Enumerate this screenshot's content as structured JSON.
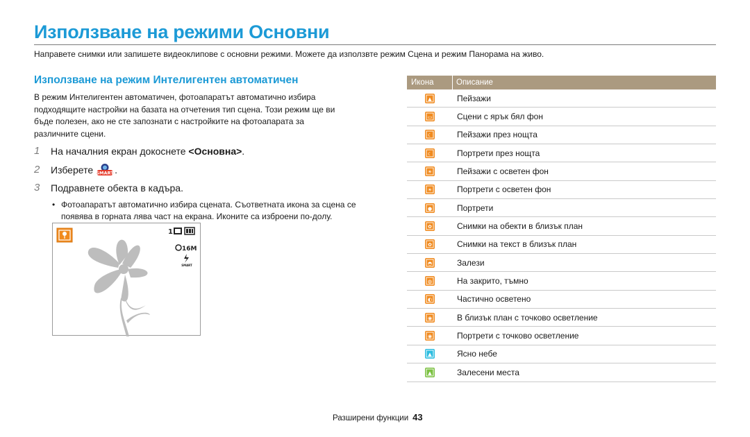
{
  "page": {
    "title": "Използване на режими Основни",
    "intro": "Направете снимки или запишете видеоклипове с основни режими. Можете да използвте режим Сцена и режим Панорама на живо."
  },
  "section": {
    "heading": "Използване на режим Интелигентен автоматичен",
    "body": "В режим Интелигентен автоматичен, фотоапаратът автоматично избира подходящите настройки на базата на отчетения тип сцена. Този режим ще ви бъде полезен, ако не сте запознати с настройките на фотоапарата за различните сцени."
  },
  "steps": [
    {
      "num": "1",
      "before": "На началния екран докоснете ",
      "bold": "<Основна>",
      "after": "."
    },
    {
      "num": "2",
      "before": "Изберете",
      "icon": "smart-auto-icon",
      "icon_label": "SMART",
      "after": "."
    },
    {
      "num": "3",
      "before": "Подравнете обекта в кадъра.",
      "bold": "",
      "after": ""
    }
  ],
  "bullet": "Фотоапаратът автоматично избира сцената. Съответната икона за сцена се появява в горната лява част на екрана. Иконите са изброени по-долу.",
  "camera_screen": {
    "scene_icon": "macro-flower-icon",
    "shots_remaining": "1",
    "size_label": "16M",
    "flash_label": "SMART"
  },
  "table": {
    "header_icon": "Икона",
    "header_desc": "Описание",
    "colors": {
      "orange": "#f08a1e",
      "cyan": "#2ebde0",
      "green": "#7cc142",
      "header": "#ab9a80"
    },
    "rows": [
      {
        "icon": "landscape-icon",
        "color": "orange",
        "glyph": "▲",
        "desc": "Пейзажи"
      },
      {
        "icon": "white-scene-icon",
        "color": "orange",
        "glyph": "▭",
        "desc": "Сцени с ярък бял фон"
      },
      {
        "icon": "night-landscape-icon",
        "color": "orange",
        "glyph": "☾",
        "desc": "Пейзажи през нощта"
      },
      {
        "icon": "night-portrait-icon",
        "color": "orange",
        "glyph": "☾",
        "desc": "Портрети през нощта"
      },
      {
        "icon": "backlight-landscape-icon",
        "color": "orange",
        "glyph": "☀",
        "desc": "Пейзажи с осветен фон"
      },
      {
        "icon": "backlight-portrait-icon",
        "color": "orange",
        "glyph": "☀",
        "desc": "Портрети с осветен фон"
      },
      {
        "icon": "portrait-icon",
        "color": "orange",
        "glyph": "●",
        "desc": "Портрети"
      },
      {
        "icon": "macro-icon",
        "color": "orange",
        "glyph": "✿",
        "desc": "Снимки на обекти в близък план"
      },
      {
        "icon": "macro-text-icon",
        "color": "orange",
        "glyph": "✿",
        "desc": "Снимки на текст в близък план"
      },
      {
        "icon": "sunset-icon",
        "color": "orange",
        "glyph": "◓",
        "desc": "Залези"
      },
      {
        "icon": "cloudy-icon",
        "color": "orange",
        "glyph": "◍",
        "desc": "На закрито, тъмно"
      },
      {
        "icon": "partly-lit-icon",
        "color": "orange",
        "glyph": "◐",
        "desc": "Частично осветено"
      },
      {
        "icon": "spotlight-macro-icon",
        "color": "orange",
        "glyph": "◉",
        "desc": "В близък план с точково осветление"
      },
      {
        "icon": "spotlight-portrait-icon",
        "color": "orange",
        "glyph": "◉",
        "desc": "Портрети с точково осветление"
      },
      {
        "icon": "clear-sky-icon",
        "color": "cyan",
        "glyph": "▲",
        "desc": "Ясно небе"
      },
      {
        "icon": "forest-icon",
        "color": "green",
        "glyph": "▲",
        "desc": "Залесени места"
      }
    ]
  },
  "footer": {
    "label": "Разширени функции",
    "page_number": "43"
  }
}
